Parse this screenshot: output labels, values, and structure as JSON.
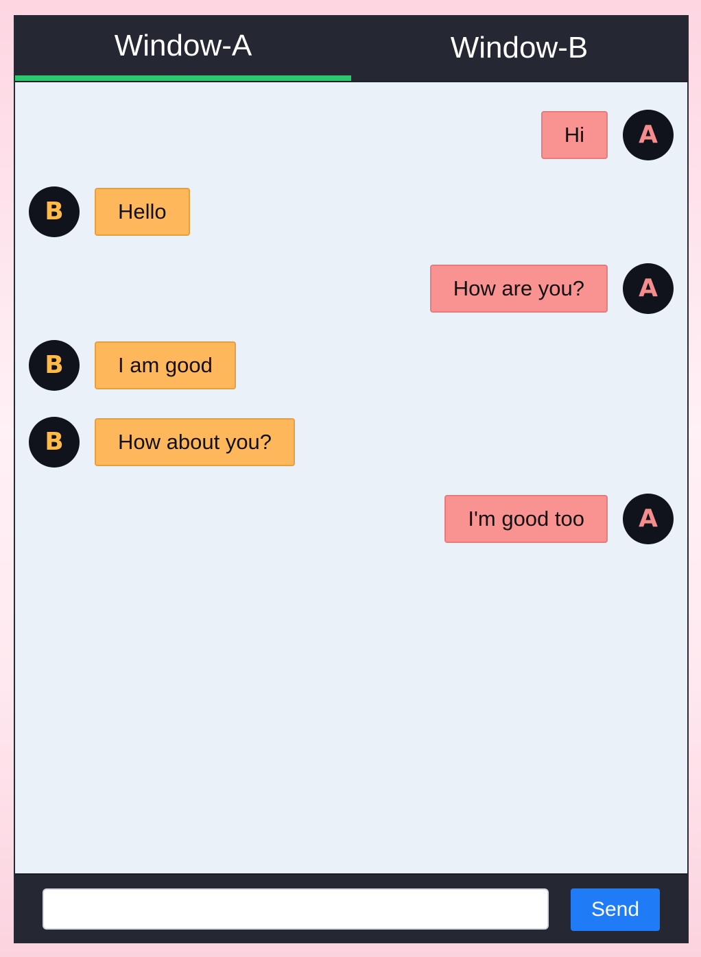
{
  "tabs": [
    {
      "label": "Window-A",
      "active": true
    },
    {
      "label": "Window-B",
      "active": false
    }
  ],
  "colors": {
    "tab_bar": "#252833",
    "active_indicator": "#2bc86f",
    "chat_background": "#eaf1f9",
    "bubble_a": "#f99392",
    "bubble_b": "#ffb75c",
    "avatar_bg": "#11131c",
    "send_button": "#1f7cf6"
  },
  "avatars": {
    "a": {
      "letter": "A"
    },
    "b": {
      "letter": "B"
    }
  },
  "messages": [
    {
      "from": "A",
      "text": "Hi"
    },
    {
      "from": "B",
      "text": "Hello"
    },
    {
      "from": "A",
      "text": "How are you?"
    },
    {
      "from": "B",
      "text": "I am good"
    },
    {
      "from": "B",
      "text": "How about you?"
    },
    {
      "from": "A",
      "text": "I'm good too"
    }
  ],
  "composer": {
    "input_value": "",
    "send_label": "Send"
  }
}
